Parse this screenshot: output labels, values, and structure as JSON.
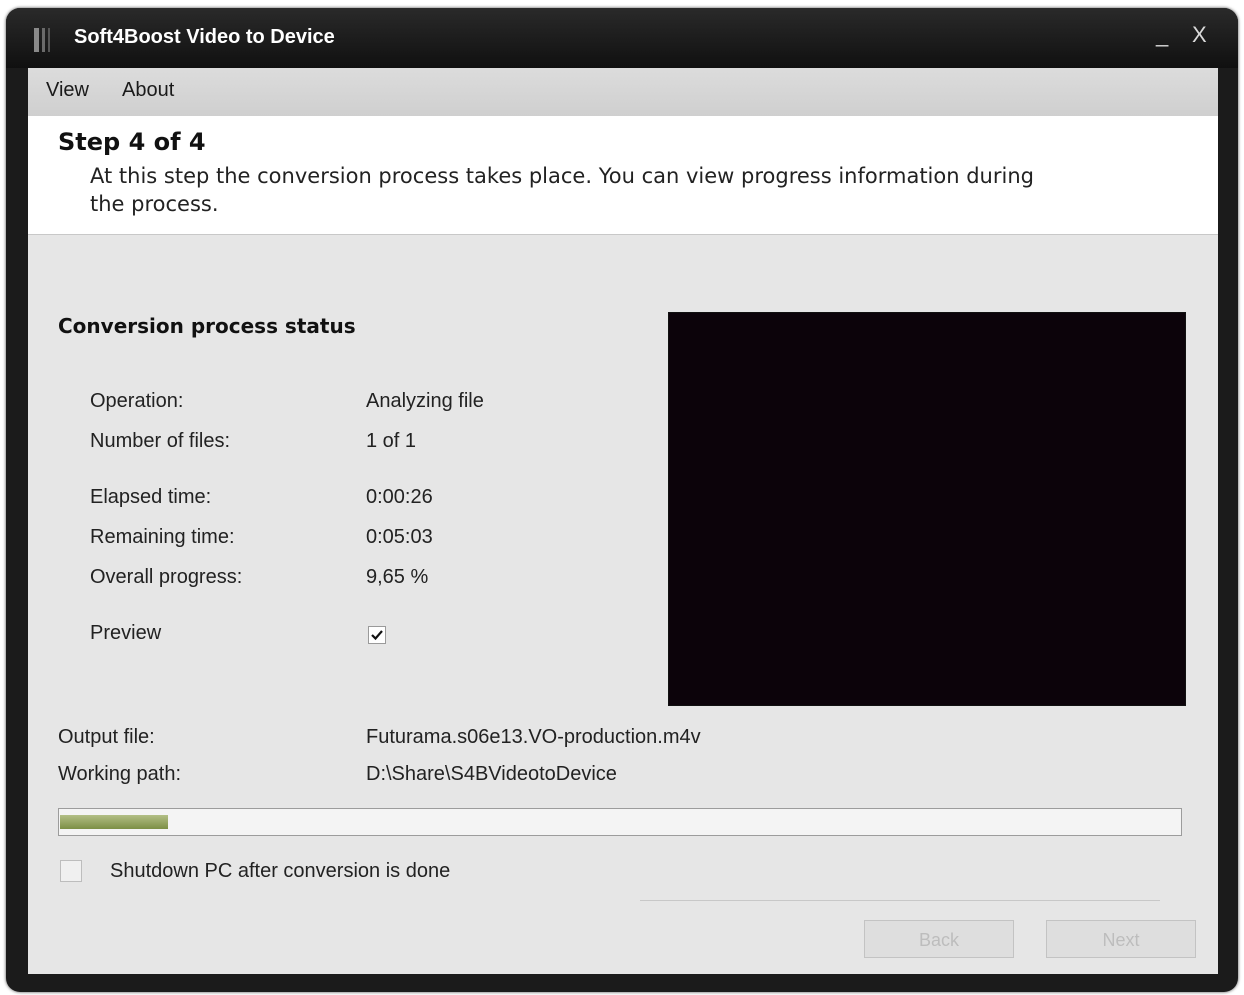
{
  "window": {
    "title": "Soft4Boost Video to Device",
    "minimize": "_",
    "close": "X"
  },
  "menu": {
    "items": [
      {
        "label": "View"
      },
      {
        "label": "About"
      }
    ]
  },
  "header": {
    "step": "Step 4 of 4",
    "description": "At this step the conversion process takes place. You can view progress information during the process."
  },
  "status": {
    "title": "Conversion process status",
    "operation_label": "Operation:",
    "operation_value": "Analyzing file",
    "files_label": "Number of files:",
    "files_value": "1 of 1",
    "elapsed_label": "Elapsed time:",
    "elapsed_value": "0:00:26",
    "remaining_label": "Remaining time:",
    "remaining_value": "0:05:03",
    "progress_label": "Overall progress:",
    "progress_value": "9,65 %",
    "preview_label": "Preview",
    "preview_checked": true,
    "output_label": "Output file:",
    "output_value": "Futurama.s06e13.VO-production.m4v",
    "path_label": "Working path:",
    "path_value": "D:\\Share\\S4BVideotoDevice"
  },
  "progress_bar": {
    "fraction": 0.0965
  },
  "shutdown": {
    "label": "Shutdown PC after conversion is done",
    "checked": false
  },
  "buttons": {
    "back": "Back",
    "next": "Next"
  },
  "colors": {
    "preview_bg": "#0c030a",
    "progress_fill": "#8a9a52"
  }
}
